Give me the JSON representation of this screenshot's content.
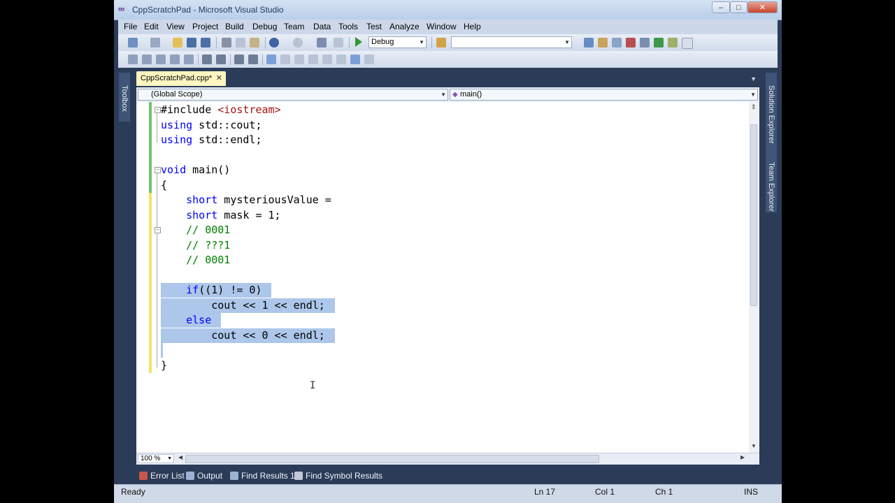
{
  "window": {
    "title": "CppScratchPad - Microsoft Visual Studio",
    "controls": [
      "–",
      "□",
      "✕"
    ]
  },
  "menu": [
    "File",
    "Edit",
    "View",
    "Project",
    "Build",
    "Debug",
    "Team",
    "Data",
    "Tools",
    "Test",
    "Analyze",
    "Window",
    "Help"
  ],
  "toolbar": {
    "config_value": "Debug",
    "find_value": ""
  },
  "editor_tab": {
    "label": "CppScratchPad.cpp*",
    "close": "✕"
  },
  "navbar": {
    "scope": "(Global Scope)",
    "member": "main()"
  },
  "side_panels": {
    "left": "Toolbox",
    "right_top": "Solution Explorer",
    "right_bottom": "Team Explorer"
  },
  "code": [
    {
      "parts": [
        [
          "tx",
          "#include "
        ],
        [
          "str",
          "<iostream>"
        ]
      ]
    },
    {
      "parts": [
        [
          "kw",
          "using"
        ],
        [
          "tx",
          " std::cout;"
        ]
      ]
    },
    {
      "parts": [
        [
          "kw",
          "using"
        ],
        [
          "tx",
          " std::endl;"
        ]
      ]
    },
    {
      "parts": []
    },
    {
      "parts": [
        [
          "kw",
          "void"
        ],
        [
          "tx",
          " main()"
        ]
      ]
    },
    {
      "parts": [
        [
          "tx",
          "{"
        ]
      ]
    },
    {
      "parts": [
        [
          "tx",
          "    "
        ],
        [
          "kw",
          "short"
        ],
        [
          "tx",
          " mysteriousValue ="
        ]
      ]
    },
    {
      "parts": [
        [
          "tx",
          "    "
        ],
        [
          "kw",
          "short"
        ],
        [
          "tx",
          " mask = 1;"
        ]
      ]
    },
    {
      "parts": [
        [
          "tx",
          "    "
        ],
        [
          "cm",
          "// 0001"
        ]
      ]
    },
    {
      "parts": [
        [
          "tx",
          "    "
        ],
        [
          "cm",
          "// ???1"
        ]
      ]
    },
    {
      "parts": [
        [
          "tx",
          "    "
        ],
        [
          "cm",
          "// 0001"
        ]
      ]
    },
    {
      "parts": []
    },
    {
      "parts": [
        [
          "tx",
          "    "
        ],
        [
          "kw",
          "if"
        ],
        [
          "tx",
          "((1) != 0)"
        ]
      ]
    },
    {
      "parts": [
        [
          "tx",
          "        cout << 1 << endl;"
        ]
      ]
    },
    {
      "parts": [
        [
          "tx",
          "    "
        ],
        [
          "kw",
          "else"
        ]
      ]
    },
    {
      "parts": [
        [
          "tx",
          "        cout << 0 << endl;"
        ]
      ]
    },
    {
      "parts": []
    },
    {
      "parts": [
        [
          "tx",
          "}"
        ]
      ]
    }
  ],
  "zoom": "100 %",
  "tool_windows": [
    "Error List",
    "Output",
    "Find Results 1",
    "Find Symbol Results"
  ],
  "status": {
    "message": "Ready",
    "line": "Ln 17",
    "col": "Col 1",
    "ch": "Ch 1",
    "mode": "INS"
  }
}
